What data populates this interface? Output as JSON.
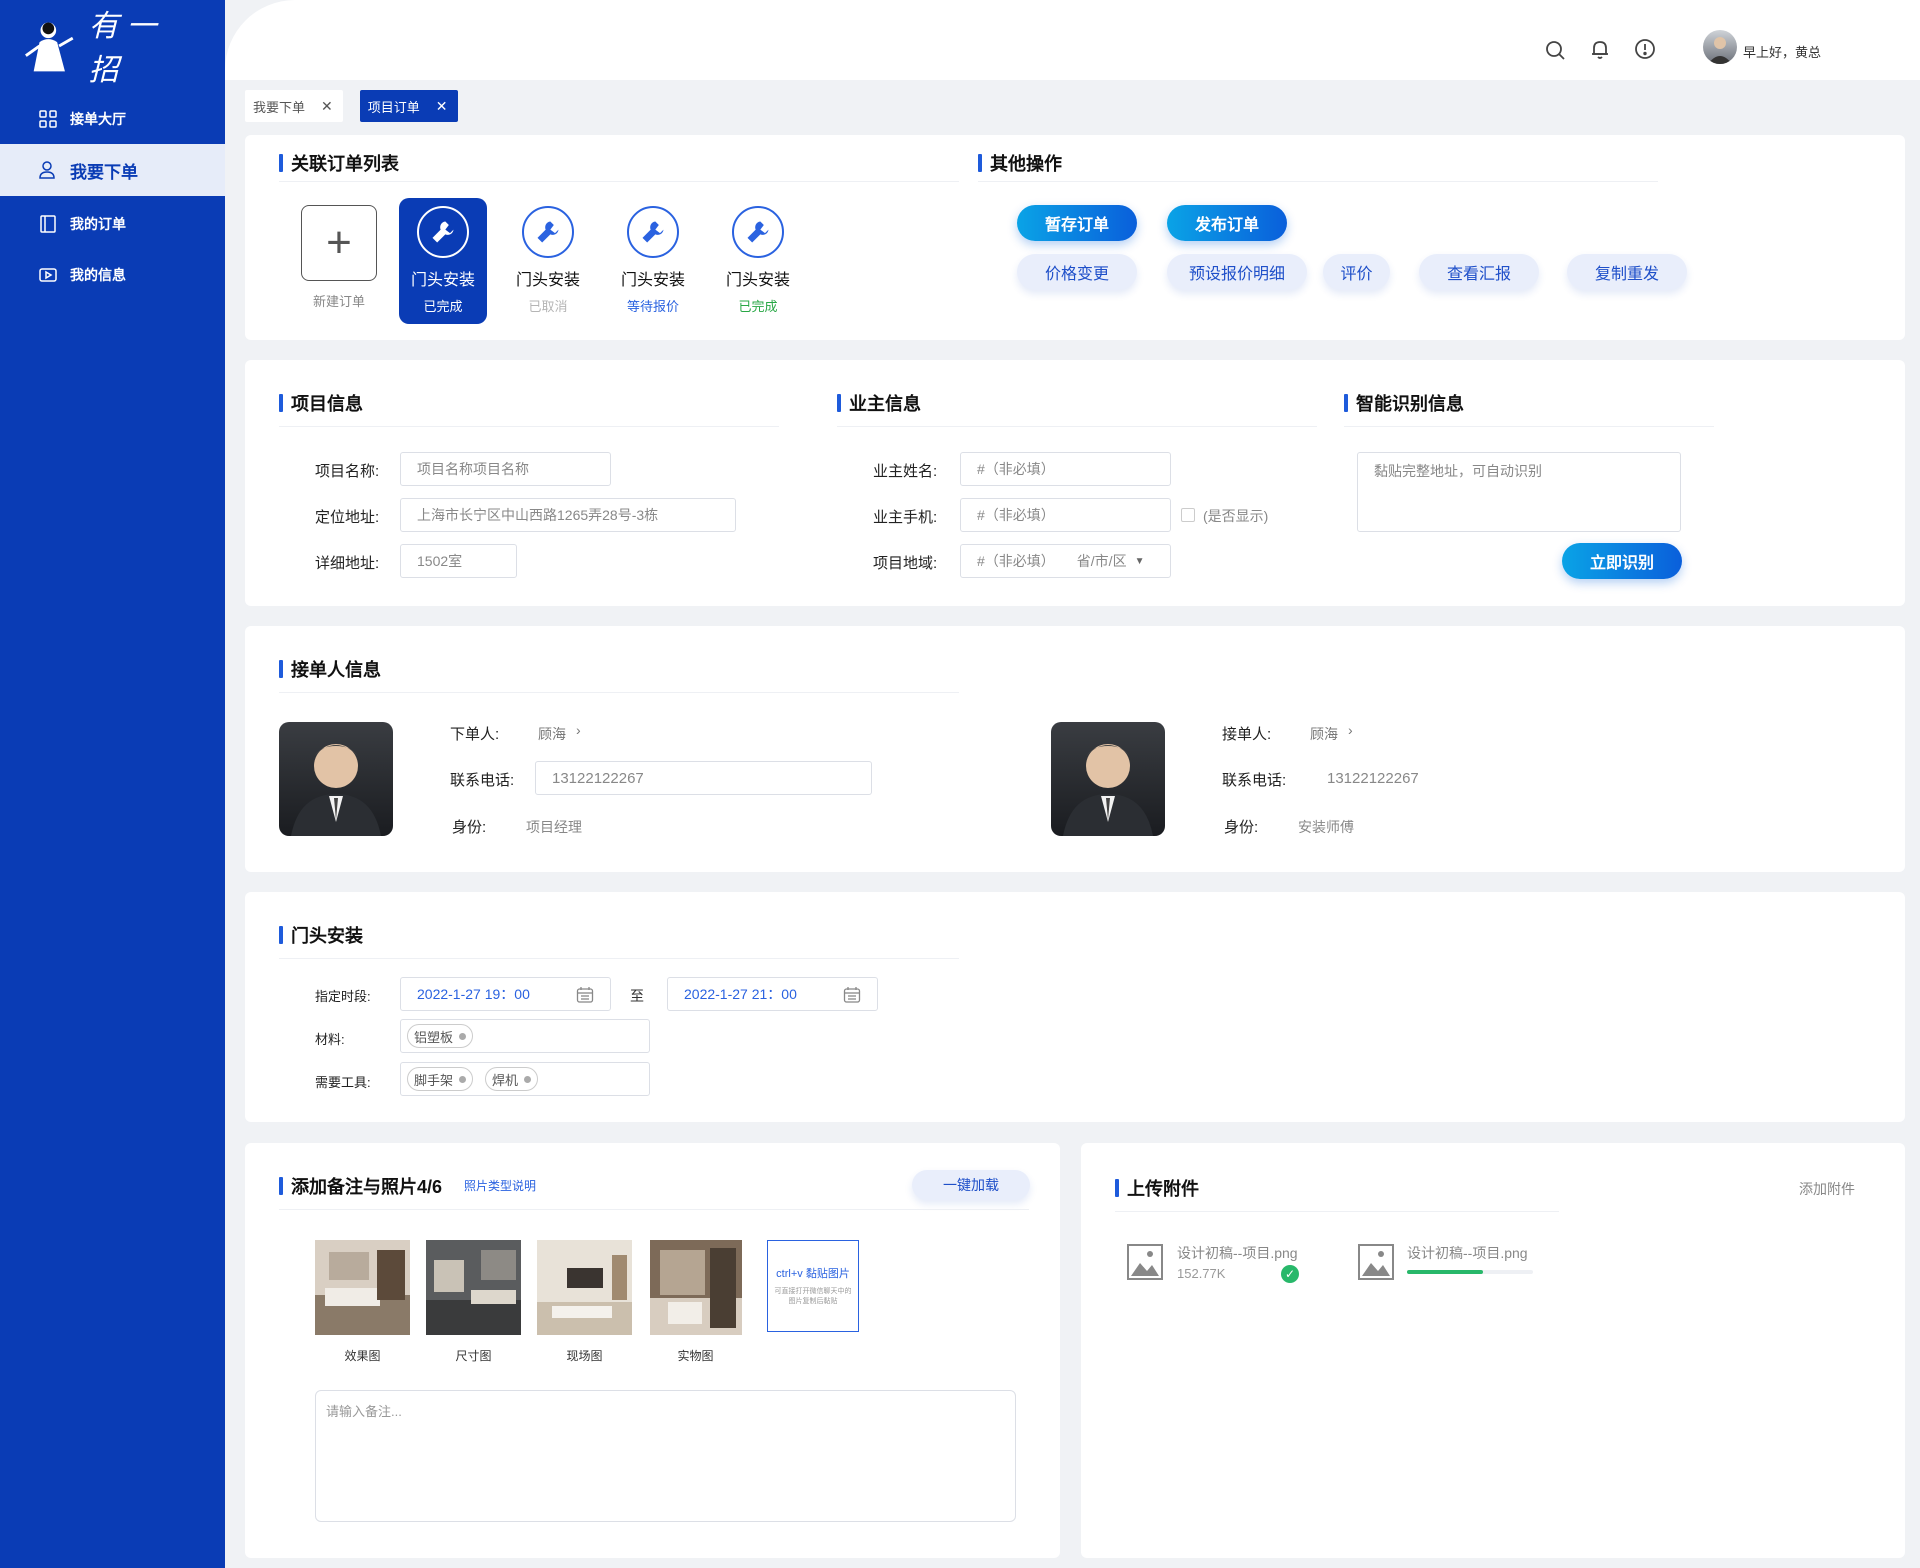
{
  "brand": {
    "logo_text": "有一招"
  },
  "sidebar": {
    "items": [
      {
        "label": "接单大厅",
        "icon": "grid-icon"
      },
      {
        "label": "我要下单",
        "icon": "user-icon"
      },
      {
        "label": "我的订单",
        "icon": "book-icon"
      },
      {
        "label": "我的信息",
        "icon": "video-icon"
      }
    ]
  },
  "header": {
    "greeting": "早上好，黄总",
    "icons": [
      "search-icon",
      "bell-icon",
      "info-icon"
    ]
  },
  "tabs": [
    {
      "label": "我要下单"
    },
    {
      "label": "项目订单"
    }
  ],
  "orders": {
    "title": "关联订单列表",
    "new_label": "新建订单",
    "items": [
      {
        "name": "门头安装",
        "status": "已完成",
        "status_color": "#ffffff"
      },
      {
        "name": "门头安装",
        "status": "已取消",
        "status_color": "#b5b5b5"
      },
      {
        "name": "门头安装",
        "status": "等待报价",
        "status_color": "#2a62e0"
      },
      {
        "name": "门头安装",
        "status": "已完成",
        "status_color": "#28a745"
      }
    ]
  },
  "ops": {
    "title": "其他操作",
    "primary": [
      "暂存订单",
      "发布订单"
    ],
    "secondary": [
      "价格变更",
      "预设报价明细",
      "评价",
      "查看汇报",
      "复制重发"
    ]
  },
  "project": {
    "title": "项目信息",
    "name_label": "项目名称:",
    "name_value": "项目名称项目名称",
    "addr_label": "定位地址:",
    "addr_value": "上海市长宁区中山西路1265弄28号-3栋",
    "detail_label": "详细地址:",
    "detail_value": "1502室"
  },
  "owner": {
    "title": "业主信息",
    "name_label": "业主姓名:",
    "name_placeholder": "#（非必填）",
    "phone_label": "业主手机:",
    "phone_placeholder": "#（非必填）",
    "show_label": "(是否显示)",
    "region_label": "项目地域:",
    "region_placeholder": "#（非必填）",
    "region_select": "省/市/区"
  },
  "smart": {
    "title": "智能识别信息",
    "placeholder": "黏贴完整地址，可自动识别",
    "button": "立即识别"
  },
  "people": {
    "title": "接单人信息",
    "placer": {
      "role_label": "下单人:",
      "name": "顾海",
      "phone_label": "联系电话:",
      "phone": "13122122267",
      "id_label": "身份:",
      "id": "项目经理"
    },
    "taker": {
      "role_label": "接单人:",
      "name": "顾海",
      "phone_label": "联系电话:",
      "phone": "13122122267",
      "id_label": "身份:",
      "id": "安装师傅"
    }
  },
  "install": {
    "title": "门头安装",
    "time_label": "指定时段:",
    "start": "2022-1-27  19：00",
    "to": "至",
    "end": "2022-1-27  21：00",
    "material_label": "材料:",
    "materials": [
      "铝塑板"
    ],
    "tool_label": "需要工具:",
    "tools": [
      "脚手架",
      "焊机"
    ]
  },
  "notes": {
    "title": "添加备注与照片4/6",
    "help_link": "照片类型说明",
    "load_button": "一键加载",
    "photos": [
      {
        "caption": "效果图"
      },
      {
        "caption": "尺寸图"
      },
      {
        "caption": "现场图"
      },
      {
        "caption": "实物图"
      }
    ],
    "paste_title": "ctrl+v 黏贴图片",
    "paste_hint": "可直接打开微信聊天中的图片复制后黏贴",
    "textarea_placeholder": "请输入备注..."
  },
  "upload": {
    "title": "上传附件",
    "add": "添加附件",
    "files": [
      {
        "name": "设计初稿--项目.png",
        "size": "152.77K",
        "done": true
      },
      {
        "name": "设计初稿--项目.png",
        "progress": 0.6
      }
    ]
  }
}
